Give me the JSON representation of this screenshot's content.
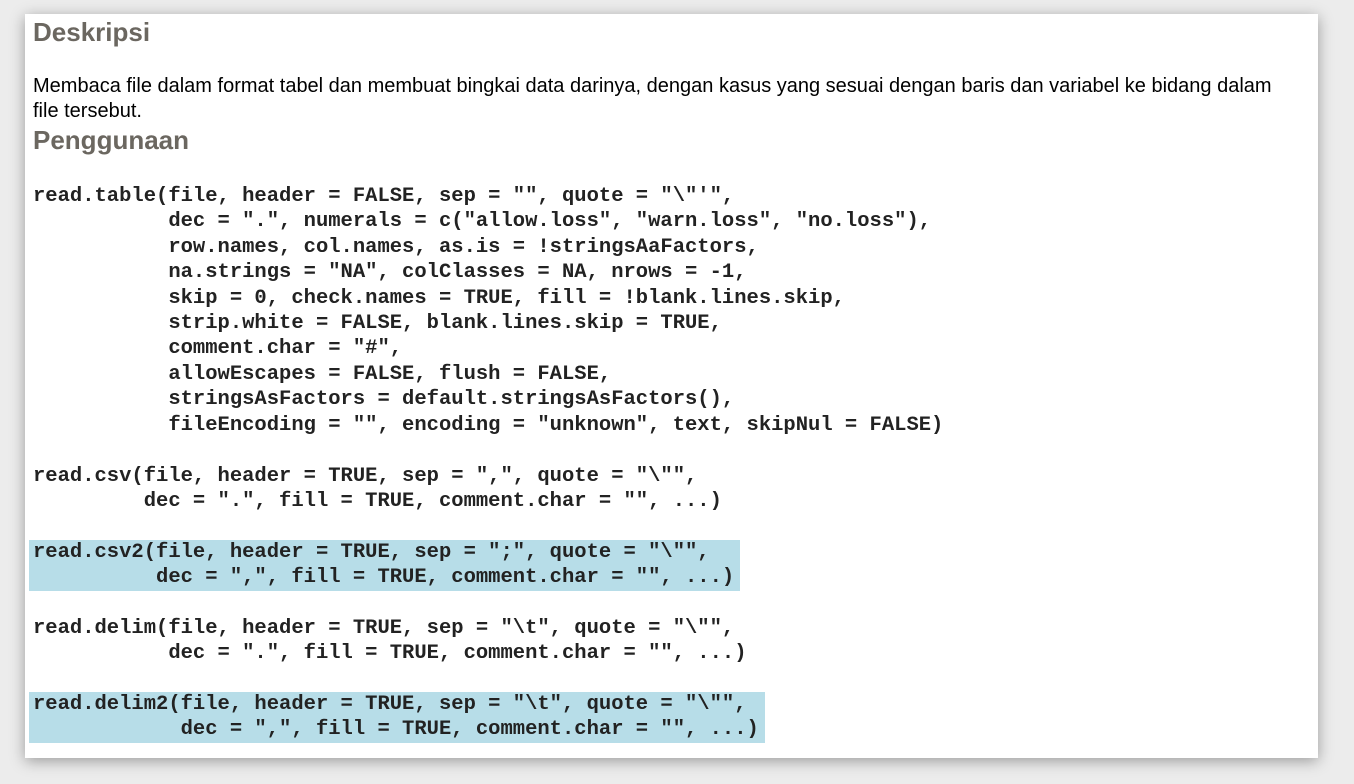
{
  "description": {
    "heading": "Deskripsi",
    "text": "Membaca file dalam format tabel dan membuat bingkai data darinya, dengan kasus yang sesuai dengan baris dan variabel ke bidang dalam file tersebut."
  },
  "usage": {
    "heading": "Penggunaan",
    "blocks": [
      {
        "name": "read.table",
        "highlighted": false,
        "code": "read.table(file, header = FALSE, sep = \"\", quote = \"\\\"'\",\n           dec = \".\", numerals = c(\"allow.loss\", \"warn.loss\", \"no.loss\"),\n           row.names, col.names, as.is = !stringsAaFactors,\n           na.strings = \"NA\", colClasses = NA, nrows = -1,\n           skip = 0, check.names = TRUE, fill = !blank.lines.skip,\n           strip.white = FALSE, blank.lines.skip = TRUE,\n           comment.char = \"#\",\n           allowEscapes = FALSE, flush = FALSE,\n           stringsAsFactors = default.stringsAsFactors(),\n           fileEncoding = \"\", encoding = \"unknown\", text, skipNul = FALSE)"
      },
      {
        "name": "read.csv",
        "highlighted": false,
        "code": "read.csv(file, header = TRUE, sep = \",\", quote = \"\\\"\",\n         dec = \".\", fill = TRUE, comment.char = \"\", ...)"
      },
      {
        "name": "read.csv2",
        "highlighted": true,
        "code": "read.csv2(file, header = TRUE, sep = \";\", quote = \"\\\"\",\n          dec = \",\", fill = TRUE, comment.char = \"\", ...)"
      },
      {
        "name": "read.delim",
        "highlighted": false,
        "code": "read.delim(file, header = TRUE, sep = \"\\t\", quote = \"\\\"\",\n           dec = \".\", fill = TRUE, comment.char = \"\", ...)"
      },
      {
        "name": "read.delim2",
        "highlighted": true,
        "code": "read.delim2(file, header = TRUE, sep = \"\\t\", quote = \"\\\"\",\n            dec = \",\", fill = TRUE, comment.char = \"\", ...)"
      }
    ]
  },
  "colors": {
    "heading": "#6b6760",
    "highlight": "#b7dde8"
  }
}
